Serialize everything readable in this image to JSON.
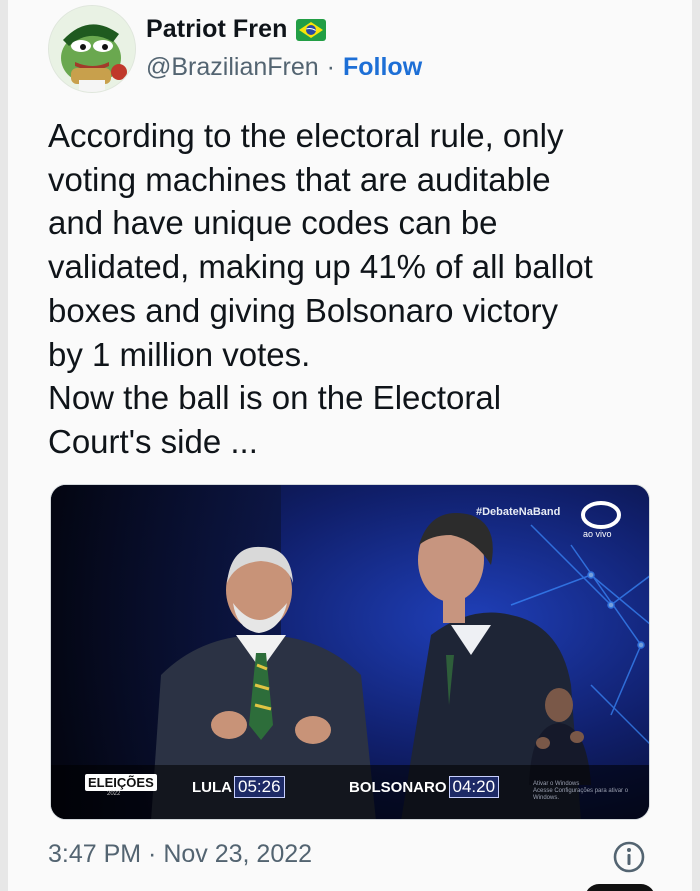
{
  "author": {
    "display_name": "Patriot Fren",
    "handle": "@BrazilianFren",
    "separator": "·",
    "follow_label": "Follow",
    "flag_icon": "brazil-flag-icon",
    "avatar_icon": "pepe-frog-avatar"
  },
  "tweet": {
    "text": "According to the electoral rule, only\nvoting machines that are auditable\nand have unique codes can be\nvalidated, making up 41% of all ballot\nboxes and giving Bolsonaro victory\nby 1 million votes.\nNow the ball is on the Electoral\nCourt's side ..."
  },
  "media": {
    "hashtag": "#DebateNaBand",
    "live_label": "ao vivo",
    "elections_label": "ELEIÇÕES",
    "elections_year": "2022",
    "candidates": [
      {
        "name": "LULA",
        "time": "05:26"
      },
      {
        "name": "BOLSONARO",
        "time": "04:20"
      }
    ],
    "watermark": "Ativar o Windows\nAcesse Configurações para ativar o Windows."
  },
  "footer": {
    "timestamp": "3:47 PM · Nov 23, 2022",
    "info_icon": "info-icon"
  },
  "colors": {
    "link": "#1d6fd6",
    "secondary_text": "#536471",
    "primary_text": "#0f1419",
    "timer_bg": "#1d2a66"
  }
}
